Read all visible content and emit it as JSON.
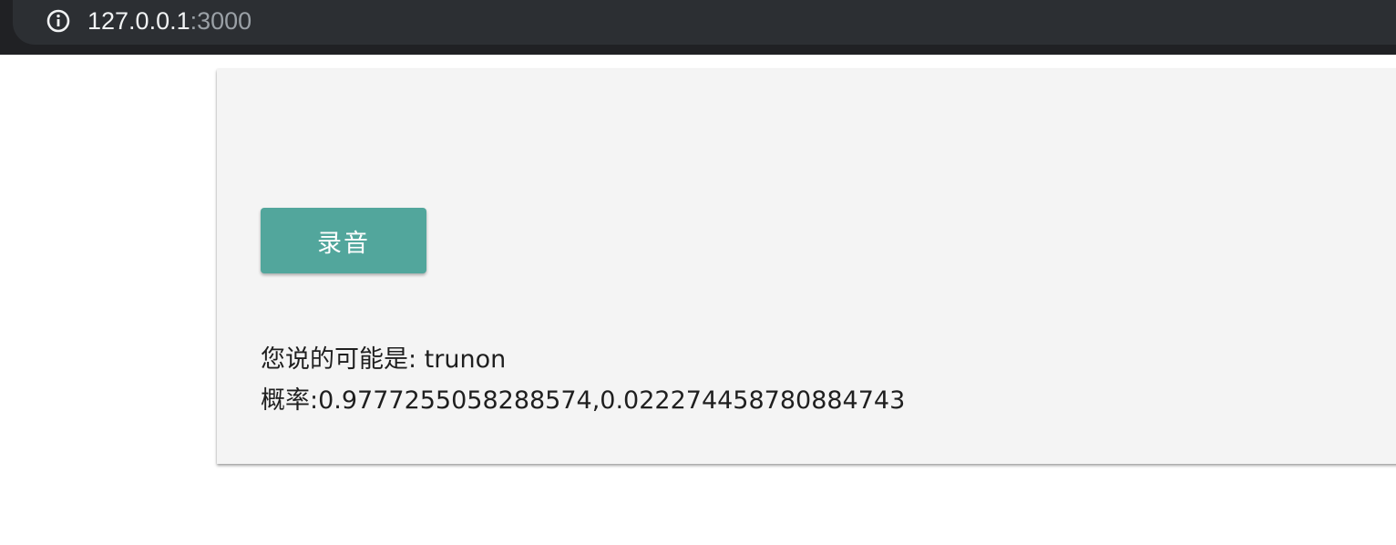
{
  "browser": {
    "url_host": "127.0.0.1",
    "url_port": ":3000",
    "icon": "info-icon"
  },
  "main": {
    "record_button_label": "录音",
    "result_label": "您说的可能是: trunon",
    "probability_label": "概率:0.9777255058288574,0.022274458780884743"
  },
  "colors": {
    "browser_bar": "#202124",
    "button": "#52a69c",
    "card": "#f4f4f4"
  }
}
